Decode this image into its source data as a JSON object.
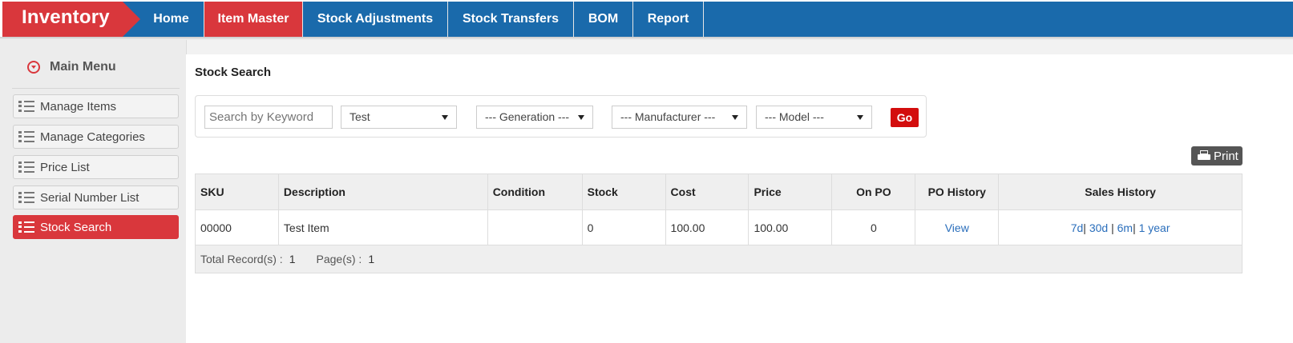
{
  "app": {
    "brand": "Inventory"
  },
  "nav": {
    "items": [
      "Home",
      "Item Master",
      "Stock Adjustments",
      "Stock Transfers",
      "BOM",
      "Report"
    ],
    "active": "Item Master"
  },
  "sidebar": {
    "header": "Main Menu",
    "items": [
      "Manage Items",
      "Manage Categories",
      "Price List",
      "Serial Number List",
      "Stock Search"
    ],
    "active": "Stock Search"
  },
  "page": {
    "title": "Stock Search"
  },
  "filters": {
    "keyword_placeholder": "Search by Keyword",
    "keyword_value": "",
    "category": "Test",
    "generation": "--- Generation ---",
    "manufacturer": "--- Manufacturer ---",
    "model": "--- Model ---",
    "go_label": "Go"
  },
  "print_label": "Print",
  "table": {
    "columns": [
      "SKU",
      "Description",
      "Condition",
      "Stock",
      "Cost",
      "Price",
      "On PO",
      "PO History",
      "Sales History"
    ],
    "rows": [
      {
        "sku": "00000",
        "description": "Test Item",
        "condition": "",
        "stock": "0",
        "cost": "100.00",
        "price": "100.00",
        "on_po": "0",
        "po_history": "View",
        "sales_history": [
          "7d",
          "30d",
          "6m",
          "1 year"
        ]
      }
    ],
    "footer": {
      "total_label": "Total Record(s) :",
      "total_value": "1",
      "pages_label": "Page(s) :",
      "pages_value": "1"
    }
  },
  "colors": {
    "nav_blue": "#1a6aab",
    "accent_red": "#d9373c",
    "go_red": "#d30d0d",
    "link_blue": "#2a6ebb"
  }
}
